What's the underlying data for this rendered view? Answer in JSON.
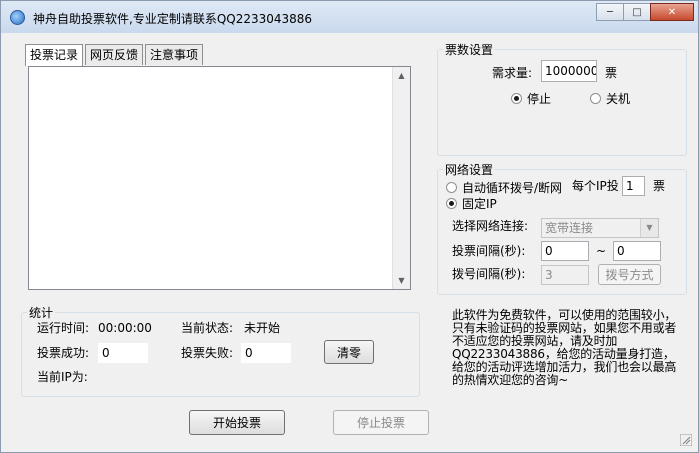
{
  "window": {
    "title": "神舟自助投票软件,专业定制请联系QQ2233043886",
    "min_icon": "minimize-icon",
    "max_icon": "maximize-icon",
    "close_icon": "close-icon"
  },
  "tabs": [
    {
      "label": "投票记录",
      "active": true
    },
    {
      "label": "网页反馈",
      "active": false
    },
    {
      "label": "注意事项",
      "active": false
    }
  ],
  "ticket": {
    "legend": "票数设置",
    "demand_label": "需求量:",
    "demand_value": "1000000",
    "demand_unit": "票",
    "stop_label": "停止",
    "shutdown_label": "关机",
    "selected": "stop"
  },
  "network": {
    "legend": "网络设置",
    "auto_dial_label": "自动循环拨号/断网",
    "per_ip_label": "每个IP投",
    "per_ip_value": "1",
    "per_ip_unit": "票",
    "fixed_ip_label": "固定IP",
    "selected": "fixed_ip",
    "connection_label": "选择网络连接:",
    "connection_value": "宽带连接",
    "vote_interval_label": "投票间隔(秒):",
    "vote_interval_min": "0",
    "vote_interval_sep": "~",
    "vote_interval_max": "0",
    "dial_interval_label": "拨号间隔(秒):",
    "dial_interval_value": "3",
    "dial_mode_label": "拨号方式"
  },
  "stats": {
    "legend": "统计",
    "runtime_label": "运行时间:",
    "runtime_value": "00:00:00",
    "status_label": "当前状态:",
    "status_value": "未开始",
    "success_label": "投票成功:",
    "success_value": "0",
    "fail_label": "投票失败:",
    "fail_value": "0",
    "reset_label": "清零",
    "ip_label": "当前IP为:"
  },
  "info_text": "此软件为免费软件，可以使用的范围较小，只有未验证码的投票网站，如果您不用或者不适应您的投票网站，请及时加QQ2233043886，给您的活动量身打造，给您的活动评选增加活力，我们也会以最高的热情欢迎您的咨询~",
  "actions": {
    "start_label": "开始投票",
    "stop_label": "停止投票"
  }
}
